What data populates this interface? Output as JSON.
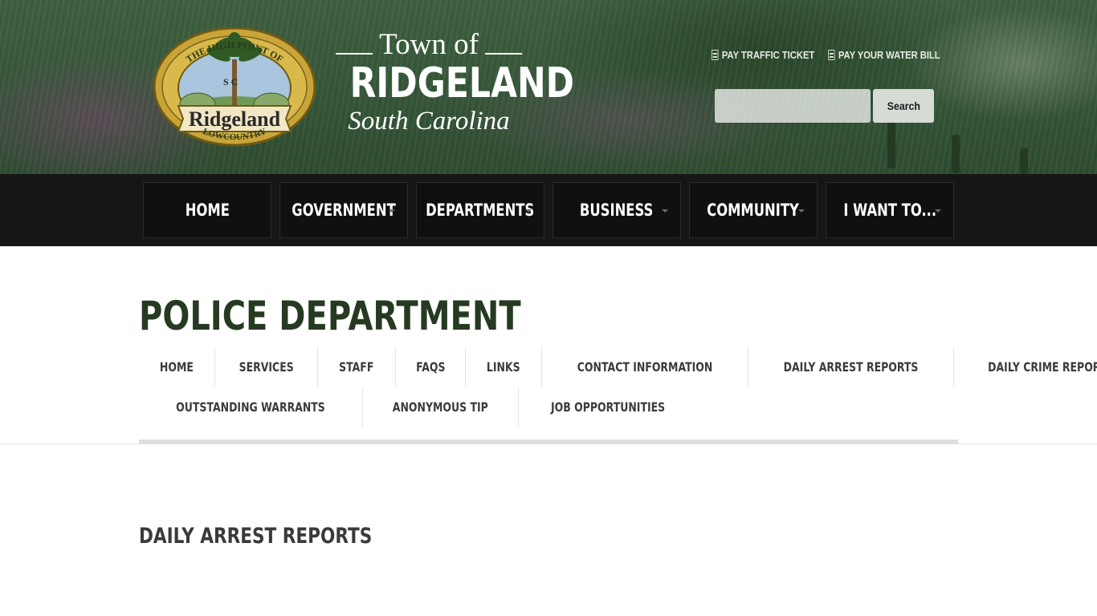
{
  "header": {
    "seal": {
      "top_arc": "THE HIGH POINT OF",
      "letters": "S C",
      "banner": "Ridgeland",
      "bottom_arc": "LOWCOUNTRY"
    },
    "wordmark": {
      "line1": "Town of",
      "line2": "RIDGELAND",
      "line3": "South Carolina"
    },
    "top_links": [
      {
        "label": "PAY TRAFFIC TICKET",
        "icon": "document-icon"
      },
      {
        "label": "PAY YOUR WATER BILL",
        "icon": "document-icon"
      }
    ],
    "search": {
      "placeholder": "",
      "value": "",
      "button_label": "Search"
    }
  },
  "main_nav": [
    {
      "label": "HOME",
      "has_dropdown": false
    },
    {
      "label": "GOVERNMENT",
      "has_dropdown": true
    },
    {
      "label": "DEPARTMENTS",
      "has_dropdown": true
    },
    {
      "label": "BUSINESS",
      "has_dropdown": true
    },
    {
      "label": "COMMUNITY",
      "has_dropdown": true
    },
    {
      "label": "I WANT TO...",
      "has_dropdown": true
    }
  ],
  "page": {
    "title": "POLICE DEPARTMENT",
    "subnav_row1": [
      "HOME",
      "SERVICES",
      "STAFF",
      "FAQS",
      "LINKS",
      "CONTACT INFORMATION",
      "DAILY ARREST REPORTS",
      "DAILY CRIME REPORTS"
    ],
    "subnav_row2": [
      "OUTSTANDING WARRANTS",
      "ANONYMOUS TIP",
      "JOB OPPORTUNITIES"
    ],
    "section_heading": "DAILY ARREST REPORTS"
  },
  "colors": {
    "header_green": "#37583a",
    "nav_black": "#161616",
    "title_green": "#263a22",
    "seal_gold": "#c9a437"
  }
}
